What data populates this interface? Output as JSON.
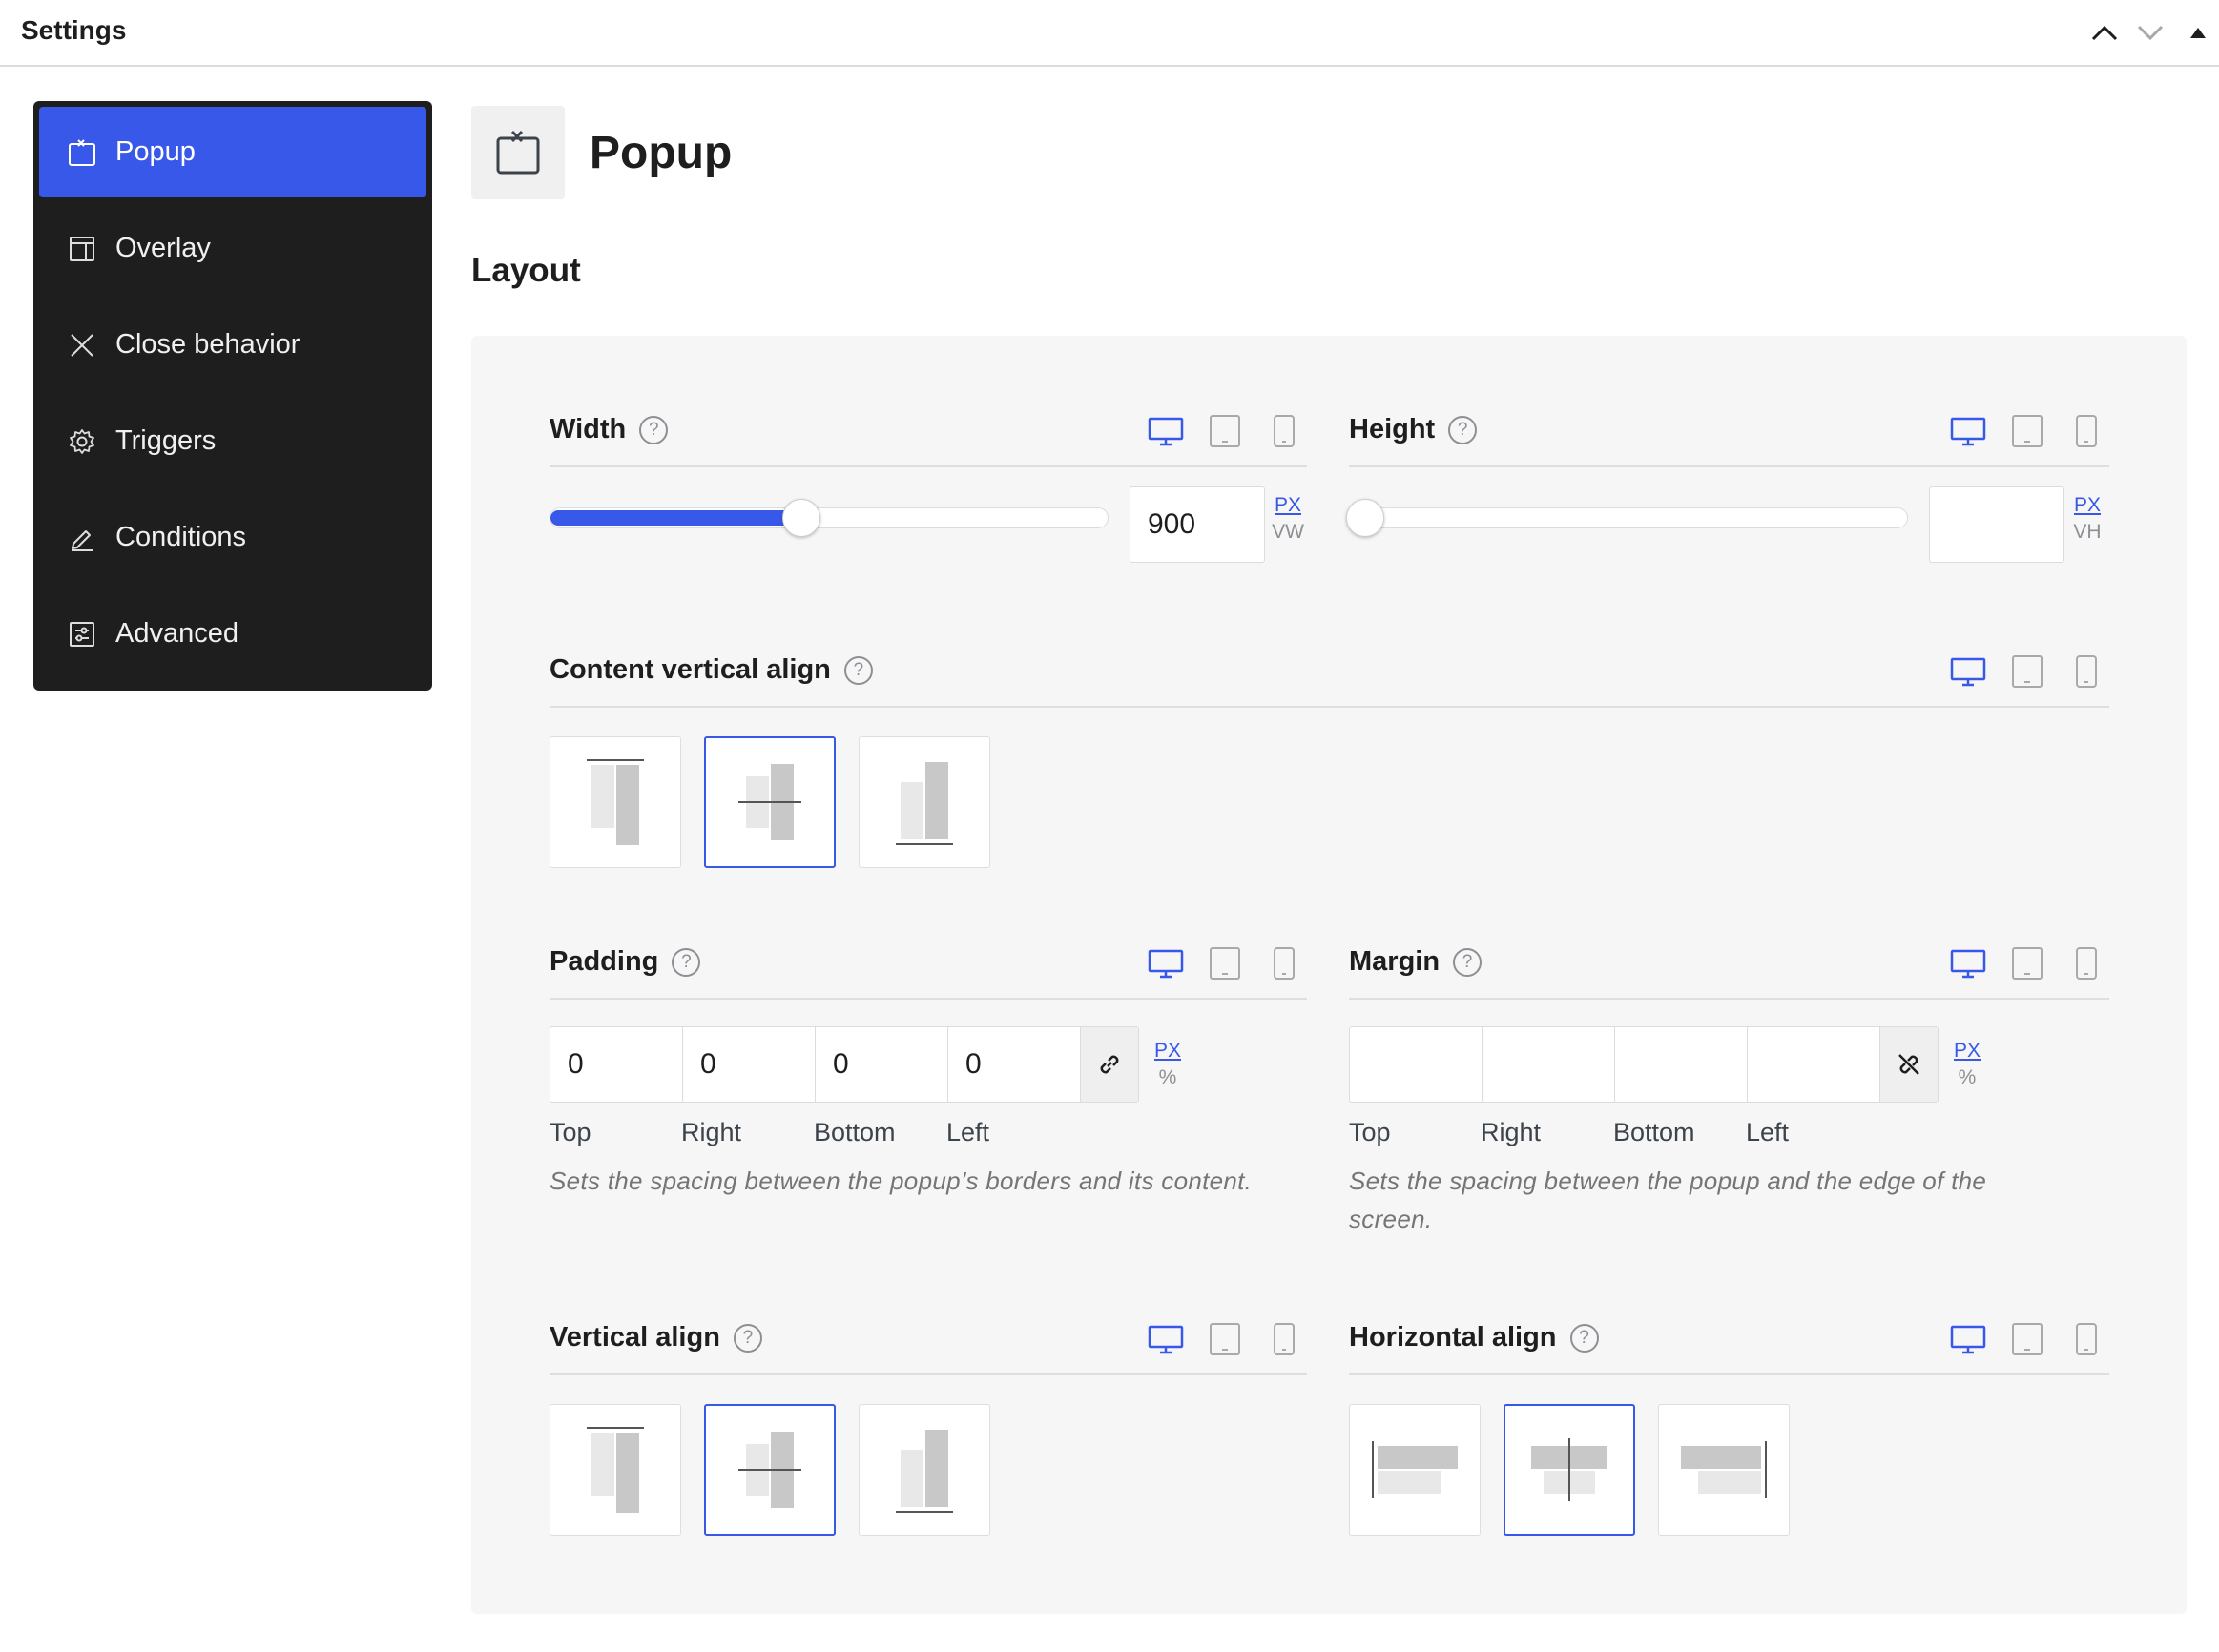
{
  "header": {
    "title": "Settings"
  },
  "colors": {
    "accent": "#3858e9",
    "sidebar_bg": "#1e1e1e",
    "panel_bg": "#f6f6f6"
  },
  "sidebar": {
    "items": [
      {
        "label": "Popup",
        "icon": "popup-icon",
        "active": true
      },
      {
        "label": "Overlay",
        "icon": "overlay-icon",
        "active": false
      },
      {
        "label": "Close behavior",
        "icon": "close-icon",
        "active": false
      },
      {
        "label": "Triggers",
        "icon": "gear-icon",
        "active": false
      },
      {
        "label": "Conditions",
        "icon": "pencil-icon",
        "active": false
      },
      {
        "label": "Advanced",
        "icon": "sliders-icon",
        "active": false
      }
    ]
  },
  "page": {
    "title": "Popup",
    "section": "Layout"
  },
  "controls": {
    "width": {
      "label": "Width",
      "value": "900",
      "units": [
        "PX",
        "VW"
      ],
      "active_unit": "PX",
      "slider_fraction": 0.45
    },
    "height": {
      "label": "Height",
      "value": "",
      "units": [
        "PX",
        "VH"
      ],
      "active_unit": "PX",
      "slider_fraction": 0
    },
    "content_valign": {
      "label": "Content vertical align",
      "selected": "center"
    },
    "padding": {
      "label": "Padding",
      "values": [
        "0",
        "0",
        "0",
        "0"
      ],
      "sides": [
        "Top",
        "Right",
        "Bottom",
        "Left"
      ],
      "units": [
        "PX",
        "%"
      ],
      "description": "Sets the spacing between the popup’s borders and its content."
    },
    "margin": {
      "label": "Margin",
      "values": [
        "",
        "",
        "",
        ""
      ],
      "sides": [
        "Top",
        "Right",
        "Bottom",
        "Left"
      ],
      "units": [
        "PX",
        "%"
      ],
      "description": "Sets the spacing between the popup and the edge of the screen."
    },
    "valign": {
      "label": "Vertical align",
      "selected": "center"
    },
    "halign": {
      "label": "Horizontal align",
      "selected": "center"
    }
  },
  "help_glyph": "?"
}
